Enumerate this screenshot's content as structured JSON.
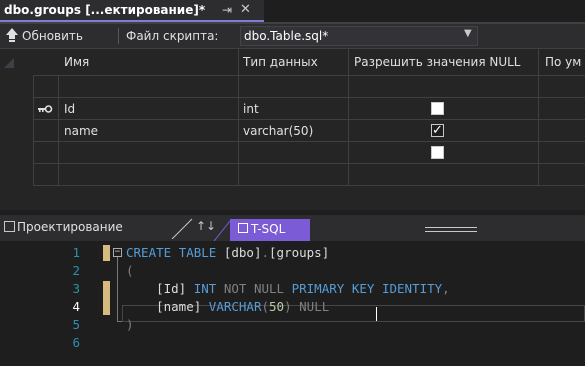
{
  "document_tab": {
    "title": "dbo.groups [...ектирование]*",
    "pin_glyph": "⇥",
    "close_glyph": "✕"
  },
  "toolbar": {
    "refresh_label": "Обновить",
    "script_label": "Файл скрипта:",
    "script_value": "dbo.Table.sql*"
  },
  "grid": {
    "headers": [
      "Имя",
      "Тип данных",
      "Разрешить значения NULL",
      "По ум"
    ],
    "rows": [
      {
        "key": true,
        "name": "Id",
        "type": "int",
        "allow_null": false
      },
      {
        "key": false,
        "name": "name",
        "type": "varchar(50)",
        "allow_null": true
      },
      {
        "key": false,
        "name": "",
        "type": "",
        "allow_null": false
      }
    ]
  },
  "bottom_tabs": {
    "design_label": "Проектирование",
    "swap_glyph": "↑↓",
    "tsql_label": "T-SQL"
  },
  "editor": {
    "line_numbers": [
      "1",
      "2",
      "3",
      "4",
      "5",
      "6"
    ],
    "current_line": "4",
    "line1": {
      "kw1": "CREATE",
      "kw2": "TABLE",
      "schema": "[dbo]",
      "dot": ".",
      "table": "[groups]"
    },
    "line2": {
      "text": "("
    },
    "line3": {
      "col": "[Id]",
      "type": "INT",
      "not_null": "NOT NULL",
      "pk": "PRIMARY KEY",
      "identity": "IDENTITY",
      "comma": ","
    },
    "line4": {
      "col": "[name]",
      "type": "VARCHAR",
      "open": "(",
      "len": "50",
      "close": ")",
      "null": "NULL"
    },
    "line5": {
      "text": ")"
    }
  },
  "colors": {
    "accent": "#7b5bd6",
    "keyword": "#569cd6",
    "line_number": "#2b91af",
    "number": "#b5cea8",
    "change_marker": "#d7ba7d"
  }
}
